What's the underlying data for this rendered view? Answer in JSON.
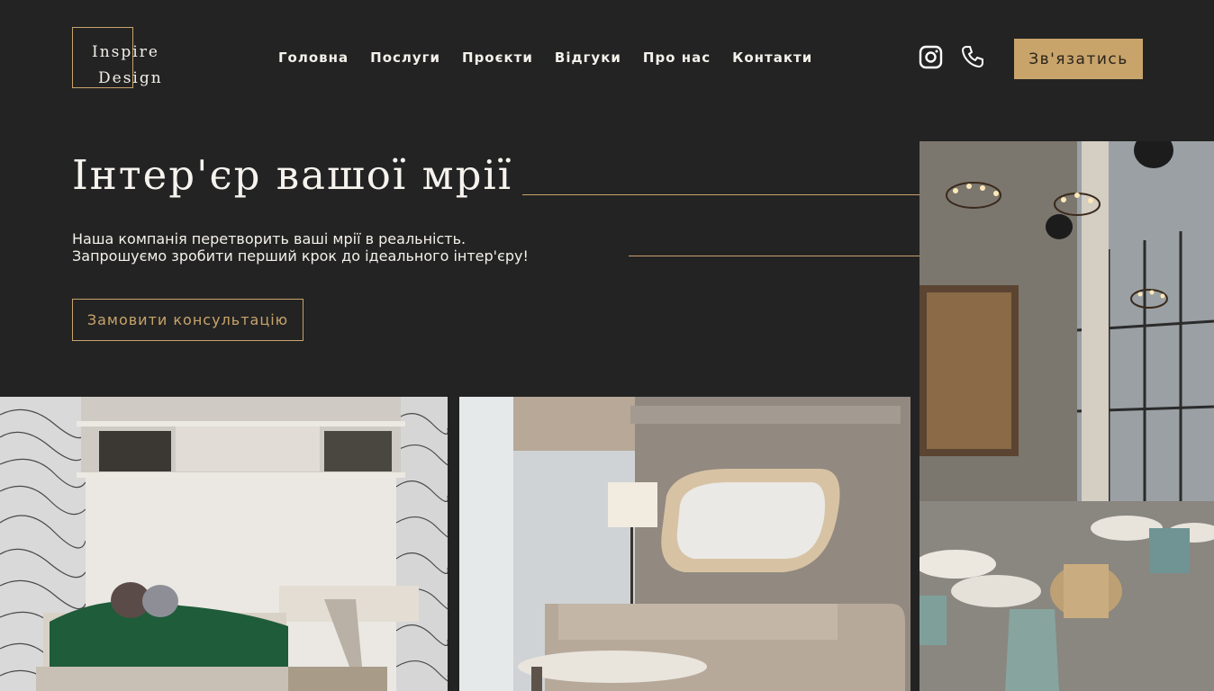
{
  "logo": {
    "line1": "Inspire",
    "line2": "Design"
  },
  "nav": {
    "items": [
      "Головна",
      "Послуги",
      "Проєкти",
      "Відгуки",
      "Про нас",
      "Контакти"
    ]
  },
  "header": {
    "cta_label": "Зв'язатись",
    "icons": [
      "instagram-icon",
      "phone-icon"
    ]
  },
  "hero": {
    "title": "Інтер'єр вашої мрії",
    "lead_line1": "Наша компанія перетворить ваші мрії в реальність.",
    "lead_line2": "Запрошуємо зробити перший крок до ідеального інтер'єру!",
    "button_label": "Замовити консультацію"
  },
  "gallery": [
    "bedroom-photo",
    "living-room-photo",
    "restaurant-photo"
  ],
  "colors": {
    "background": "#232323",
    "accent": "#c8a46b",
    "text": "#f4f1eb"
  }
}
